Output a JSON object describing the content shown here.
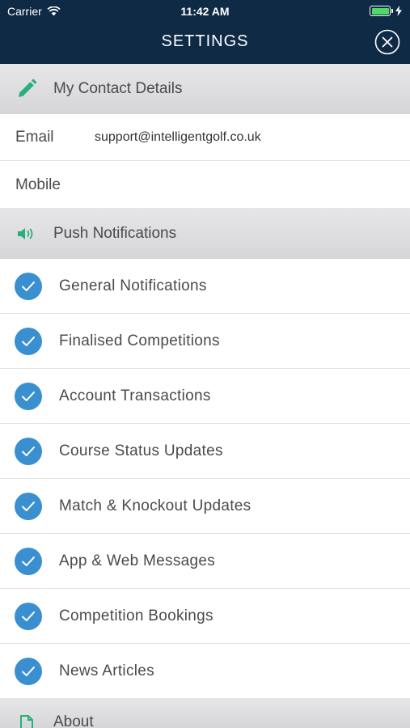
{
  "status_bar": {
    "carrier": "Carrier",
    "time": "11:42 AM"
  },
  "header": {
    "title": "SETTINGS"
  },
  "contact_section": {
    "label": "My Contact Details",
    "email_label": "Email",
    "email_value": "support@intelligentgolf.co.uk",
    "mobile_label": "Mobile",
    "mobile_value": ""
  },
  "push_section": {
    "label": "Push Notifications",
    "items": [
      {
        "label": "General Notifications",
        "checked": true
      },
      {
        "label": "Finalised Competitions",
        "checked": true
      },
      {
        "label": "Account Transactions",
        "checked": true
      },
      {
        "label": "Course Status Updates",
        "checked": true
      },
      {
        "label": "Match & Knockout Updates",
        "checked": true
      },
      {
        "label": "App & Web Messages",
        "checked": true
      },
      {
        "label": "Competition Bookings",
        "checked": true
      },
      {
        "label": "News Articles",
        "checked": true
      }
    ]
  },
  "about_section": {
    "label": "About"
  },
  "colors": {
    "header_bg": "#0e2a45",
    "accent_green": "#27b07a",
    "check_blue": "#3a8fd0"
  },
  "icons": {
    "edit": "pencil-icon",
    "push": "speaker-icon",
    "about": "document-icon",
    "close": "close-icon",
    "check": "checkmark-icon"
  }
}
